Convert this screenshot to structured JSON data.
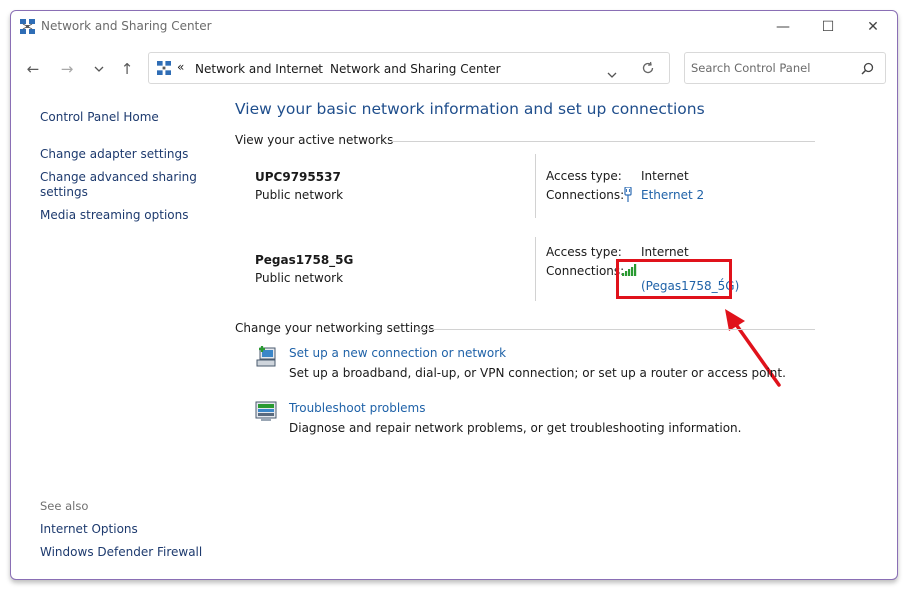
{
  "window": {
    "title": "Network and Sharing Center",
    "minimize": "—",
    "maximize": "☐",
    "close": "✕"
  },
  "address_bar": {
    "overflow": "«",
    "crumbs": [
      "Network and Internet",
      "Network and Sharing Center"
    ],
    "separator": "›"
  },
  "search": {
    "placeholder": "Search Control Panel"
  },
  "sidebar": {
    "items": [
      "Control Panel Home",
      "Change adapter settings",
      "Change advanced sharing settings",
      "Media streaming options"
    ],
    "see_also_title": "See also",
    "see_also": [
      "Internet Options",
      "Windows Defender Firewall"
    ]
  },
  "main": {
    "heading": "View your basic network information and set up connections",
    "active_networks_label": "View your active networks",
    "networks": [
      {
        "name": "UPC9795537",
        "category": "Public network",
        "access_label": "Access type:",
        "access_value": "Internet",
        "connections_label": "Connections:",
        "connection": "Ethernet 2"
      },
      {
        "name": "Pegas1758_5G",
        "category": "Public network",
        "access_label": "Access type:",
        "access_value": "Internet",
        "connections_label": "Connections:",
        "connection": "(Pegas1758_5́G)"
      }
    ],
    "change_settings_label": "Change your networking settings",
    "tasks": [
      {
        "title": "Set up a new connection or network",
        "description": "Set up a broadband, dial-up, or VPN connection; or set up a router or access point."
      },
      {
        "title": "Troubleshoot problems",
        "description": "Diagnose and repair network problems, or get troubleshooting information."
      }
    ]
  },
  "colors": {
    "heading": "#1f4e8c",
    "link": "#1f62a8",
    "annotation": "#e0121b",
    "wifi": "#2a9a32"
  }
}
